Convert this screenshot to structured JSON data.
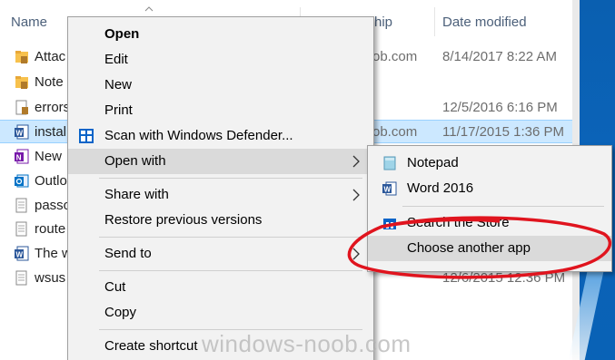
{
  "header": {
    "col_name": "Name",
    "col_relationship_partial": "hip",
    "col_date_modified": "Date modified"
  },
  "files": [
    {
      "name": "Attac",
      "icon": "folder-lock-icon",
      "relationship": "",
      "date": ""
    },
    {
      "name": "Note",
      "icon": "folder-lock-icon",
      "relationship": "ob.com",
      "date": "8/14/2017 8:22 AM"
    },
    {
      "name": "errors",
      "icon": "text-file-lock-icon",
      "relationship": "",
      "date": "12/5/2016 6:16 PM"
    },
    {
      "name": "instal",
      "icon": "word-doc-icon",
      "relationship": "ob.com",
      "date": "11/17/2015 1:36 PM",
      "selected": true
    },
    {
      "name": "New",
      "icon": "onenote-icon",
      "relationship": "",
      "date": ""
    },
    {
      "name": "Outlo",
      "icon": "outlook-icon",
      "relationship": "",
      "date": ""
    },
    {
      "name": "passo",
      "icon": "text-file-icon",
      "relationship": "",
      "date": ""
    },
    {
      "name": "route",
      "icon": "text-file-icon",
      "relationship": "",
      "date": ""
    },
    {
      "name": "The w",
      "icon": "word-doc-icon",
      "relationship": "",
      "date": ""
    },
    {
      "name": "wsus",
      "icon": "text-file-icon",
      "relationship": "",
      "date": "12/6/2015 12:36 PM"
    }
  ],
  "top_row_date": "8/14/2017 8:22 AM",
  "context_menu": {
    "open": "Open",
    "edit": "Edit",
    "new": "New",
    "print": "Print",
    "scan": "Scan with Windows Defender...",
    "open_with": "Open with",
    "share_with": "Share with",
    "restore": "Restore previous versions",
    "send_to": "Send to",
    "cut": "Cut",
    "copy": "Copy",
    "create_shortcut": "Create shortcut"
  },
  "submenu": {
    "notepad": "Notepad",
    "word": "Word 2016",
    "search_store": "Search the Store",
    "choose_app": "Choose another app"
  },
  "colors": {
    "selection": "#cce8ff",
    "menu_bg": "#f2f2f2",
    "menu_hover": "#dadada",
    "annotation_red": "#e0141e"
  },
  "watermark": "windows-noob.com"
}
